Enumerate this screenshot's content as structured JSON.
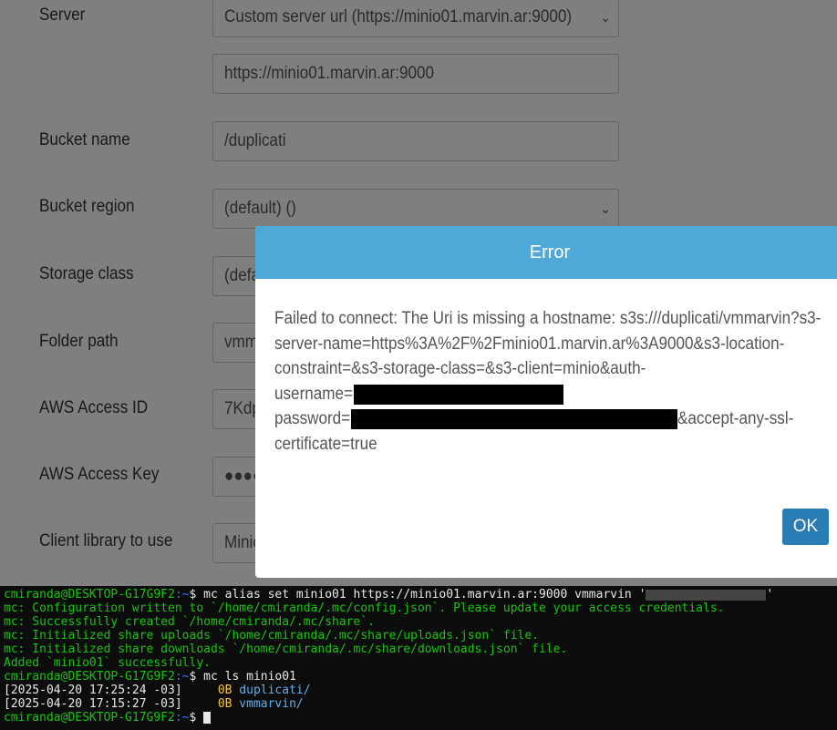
{
  "form": {
    "server": {
      "label": "Server",
      "value": "Custom server url (https://minio01.marvin.ar:9000)",
      "chevron": "chevron-down-icon"
    },
    "server_url": {
      "value": "https://minio01.marvin.ar:9000"
    },
    "bucket_name": {
      "label": "Bucket name",
      "value": "/duplicati"
    },
    "bucket_region": {
      "label": "Bucket region",
      "value": "(default) ()",
      "chevron": "chevron-down-icon"
    },
    "storage_class": {
      "label": "Storage class",
      "value": "(defa"
    },
    "folder_path": {
      "label": "Folder path",
      "value": "vmm"
    },
    "aws_access_id": {
      "label": "AWS Access ID",
      "value": "7Kdp"
    },
    "aws_access_key": {
      "label": "AWS Access Key",
      "value": "●●●●"
    },
    "client_library": {
      "label": "Client library to use",
      "value": "Minio"
    }
  },
  "modal": {
    "title": "Error",
    "message_lines": [
      "Failed to connect: The Uri is missing a hostname: s3s:///duplicati/vmmarvin?s3-",
      "server-name=https%3A%2F%2Fminio01.marvin.ar%3A9000&s3-location-",
      "constraint=&s3-storage-class=&s3-client=minio&auth-",
      "username=",
      "password=",
      "&accept-any-ssl-",
      "certificate=true"
    ],
    "ok_label": "OK",
    "header_color": "#4ea9d9",
    "button_color": "#2a7cb5"
  },
  "terminal": {
    "prompt_user": "cmiranda@DESKTOP-G17G9F2",
    "prompt_path": ":~",
    "prompt_symbol": "$ ",
    "cmd1": "mc alias set minio01 https://minio01.marvin.ar:9000 vmmarvin '",
    "cmd1_end": "'",
    "out1": "mc: Configuration written to `/home/cmiranda/.mc/config.json`. Please update your access credentials.",
    "out2": "mc: Successfully created `/home/cmiranda/.mc/share`.",
    "out3": "mc: Initialized share uploads `/home/cmiranda/.mc/share/uploads.json` file.",
    "out4": "mc: Initialized share downloads `/home/cmiranda/.mc/share/downloads.json` file.",
    "out5": "Added `minio01` successfully.",
    "cmd2": "mc ls minio01",
    "ls": [
      {
        "time": "[2025-04-20 17:25:24 -03]",
        "size": "0B",
        "name": "duplicati/"
      },
      {
        "time": "[2025-04-20 17:15:27 -03]",
        "size": "0B",
        "name": "vmmarvin/"
      }
    ]
  }
}
